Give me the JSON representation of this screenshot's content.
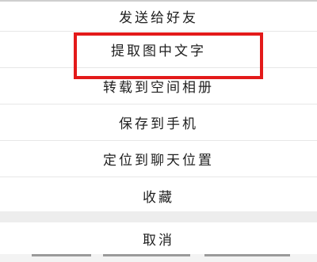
{
  "menu": {
    "items": [
      {
        "label": "发送给好友"
      },
      {
        "label": "提取图中文字"
      },
      {
        "label": "转载到空间相册"
      },
      {
        "label": "保存到手机"
      },
      {
        "label": "定位到聊天位置"
      },
      {
        "label": "收藏"
      }
    ],
    "cancel_label": "取消"
  },
  "highlight": {
    "color": "#e31a1a",
    "target": "提取图中文字"
  }
}
